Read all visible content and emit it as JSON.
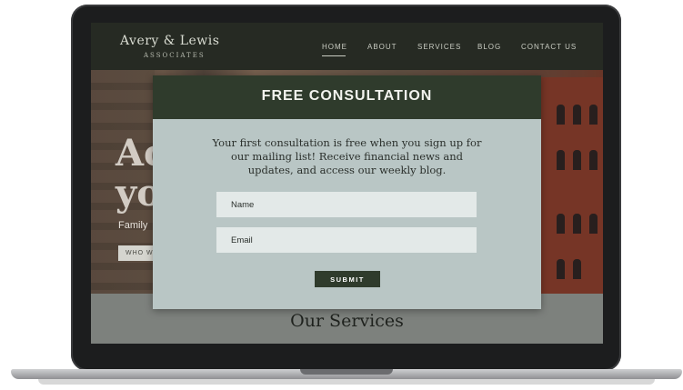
{
  "site": {
    "logo_main": "Avery & Lewis",
    "logo_sub": "ASSOCIATES",
    "nav": [
      "HOME",
      "ABOUT",
      "SERVICES",
      "BLOG",
      "CONTACT US"
    ],
    "hero_heading_line1": "Ac",
    "hero_heading_line2": "yo",
    "hero_sub": "Family",
    "hero_button": "WHO W",
    "services_title": "Our Services"
  },
  "modal": {
    "title": "FREE CONSULTATION",
    "body": "Your first consultation is free when you sign up for our mailing list! Receive financial news and updates, and access our weekly blog.",
    "name_placeholder": "Name",
    "email_placeholder": "Email",
    "submit_label": "SUBMIT"
  },
  "colors": {
    "nav_bg": "#262a23",
    "modal_header": "#2f3b2c",
    "modal_bg": "#b9c6c5",
    "field_bg": "#e3e9e8"
  }
}
